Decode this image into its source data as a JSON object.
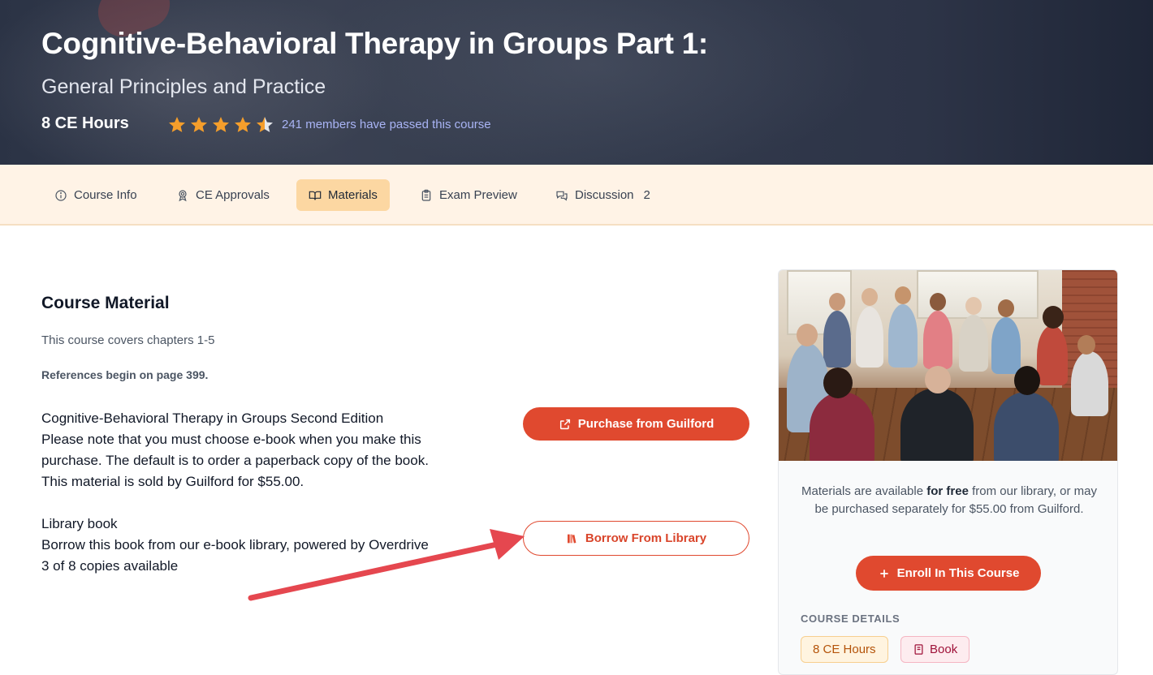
{
  "hero": {
    "title": "Cognitive-Behavioral Therapy in Groups Part 1:",
    "subtitle": "General Principles and Practice",
    "ce_hours": "8 CE Hours",
    "rating": 4.5,
    "passed_text": "241 members have passed this course"
  },
  "tabs": [
    {
      "label": "Course Info",
      "icon": "info-circle-icon"
    },
    {
      "label": "CE Approvals",
      "icon": "award-ribbon-icon"
    },
    {
      "label": "Materials",
      "icon": "open-book-icon",
      "active": true
    },
    {
      "label": "Exam Preview",
      "icon": "clipboard-icon"
    },
    {
      "label": "Discussion",
      "icon": "chat-bubbles-icon",
      "count": "2"
    }
  ],
  "main": {
    "section_title": "Course Material",
    "covers": "This course covers chapters 1-5",
    "references": "References begin on page 399.",
    "purchase": {
      "lines": [
        "Cognitive-Behavioral Therapy in Groups Second Edition",
        "Please note that you must choose e-book when you make this",
        "purchase. The default is to order a paperback copy of the book.",
        "This material is sold by Guilford for $55.00."
      ],
      "button_label": "Purchase from Guilford"
    },
    "library": {
      "lines": [
        "Library book",
        "Borrow this book from our e-book library, powered by Overdrive",
        "3 of 8 copies available"
      ],
      "button_label": "Borrow From Library"
    }
  },
  "sidebar": {
    "text_before": "Materials are available ",
    "text_bold": "for free",
    "text_after": " from our library, or may be purchased separately for $55.00 from Guilford.",
    "enroll_label": "Enroll In This Course",
    "details_label": "COURSE DETAILS",
    "tag_hours": "8 CE Hours",
    "tag_book": "Book"
  },
  "colors": {
    "accent": "#e0492f",
    "tab_bar": "#fff3e6",
    "tab_active": "#fcd7a2",
    "star": "#f59e2b",
    "link": "#a9b4f5"
  }
}
